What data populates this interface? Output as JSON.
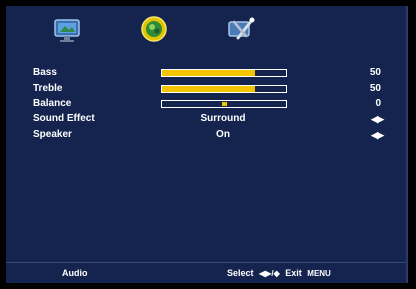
{
  "tabs": [
    {
      "name": "picture",
      "icon": "tv-screen-icon",
      "active": false
    },
    {
      "name": "sound",
      "icon": "speaker-circle-icon",
      "active": true
    },
    {
      "name": "setup",
      "icon": "tools-icon",
      "active": false
    }
  ],
  "settings": {
    "bass": {
      "label": "Bass",
      "value": "50",
      "level": 0.75
    },
    "treble": {
      "label": "Treble",
      "value": "50",
      "level": 0.75
    },
    "balance": {
      "label": "Balance",
      "value": "0",
      "position": 0.5
    },
    "sound_effect": {
      "label": "Sound Effect",
      "value": "Surround",
      "arrows": "◀▶"
    },
    "speaker": {
      "label": "Speaker",
      "value": "On",
      "arrows": "◀▶"
    }
  },
  "footer": {
    "title": "Audio",
    "select_label": "Select",
    "select_keys": "◀▶/◆",
    "exit_label": "Exit",
    "exit_key": "MENU"
  },
  "colors": {
    "background": "#15244f",
    "bar_fill": "#f3c400",
    "text": "#ffffff"
  }
}
